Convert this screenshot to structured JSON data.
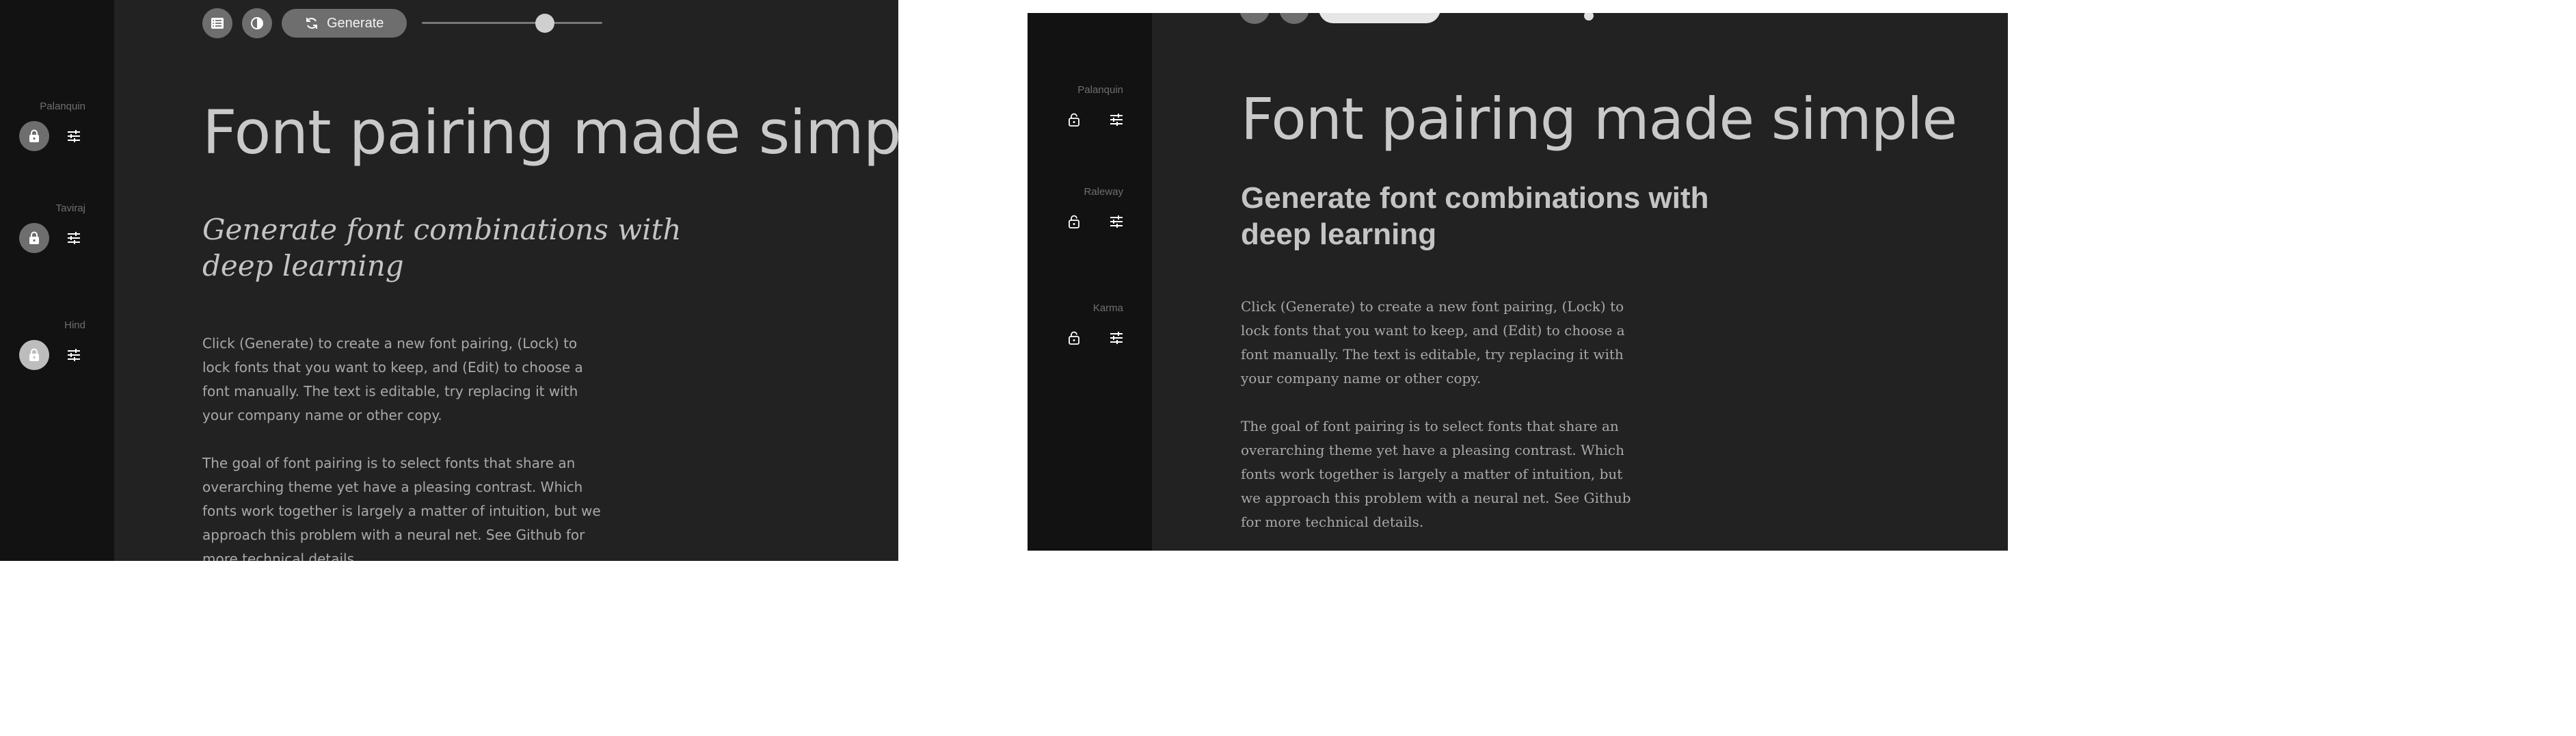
{
  "toolbar": {
    "list_icon": "list-icon",
    "contrast_icon": "contrast-icon",
    "generate_icon": "refresh-icon",
    "generate_label": "Generate",
    "slider_value_fraction": 0.68
  },
  "panel_a": {
    "fonts": [
      {
        "name": "Palanquin",
        "locked": true
      },
      {
        "name": "Taviraj",
        "locked": true
      },
      {
        "name": "Hind",
        "locked": true
      }
    ],
    "title": "Font pairing made simple",
    "subtitle": "Generate font combinations with deep learning",
    "paragraph1": "Click (Generate) to create a new font pairing, (Lock) to lock fonts that you want to keep, and (Edit) to choose a font manually. The text is editable, try replacing it with your company name or other copy.",
    "paragraph2": "The goal of font pairing is to select fonts that share an overarching theme yet have a pleasing contrast. Which fonts work together is largely a matter of intuition, but we approach this problem with a neural net. See Github for more technical details."
  },
  "panel_b": {
    "fonts": [
      {
        "name": "Palanquin",
        "locked": false
      },
      {
        "name": "Raleway",
        "locked": false
      },
      {
        "name": "Karma",
        "locked": false
      }
    ],
    "title": "Font pairing made simple",
    "subtitle": "Generate font combinations with deep learning",
    "paragraph1": "Click (Generate) to create a new font pairing, (Lock) to lock fonts that you want to keep, and (Edit) to choose a font manually. The text is editable, try replacing it with your company name or other copy.",
    "paragraph2": "The goal of font pairing is to select fonts that share an overarching theme yet have a pleasing contrast. Which fonts work together is largely a matter of intuition, but we approach this problem with a neural net. See Github for more technical details."
  },
  "colors": {
    "page_background": "#ffffff",
    "content_background": "#222222",
    "sidebar_background": "#121212",
    "button_gray": "#6e6e6e",
    "text_light": "#c9c9c9"
  }
}
